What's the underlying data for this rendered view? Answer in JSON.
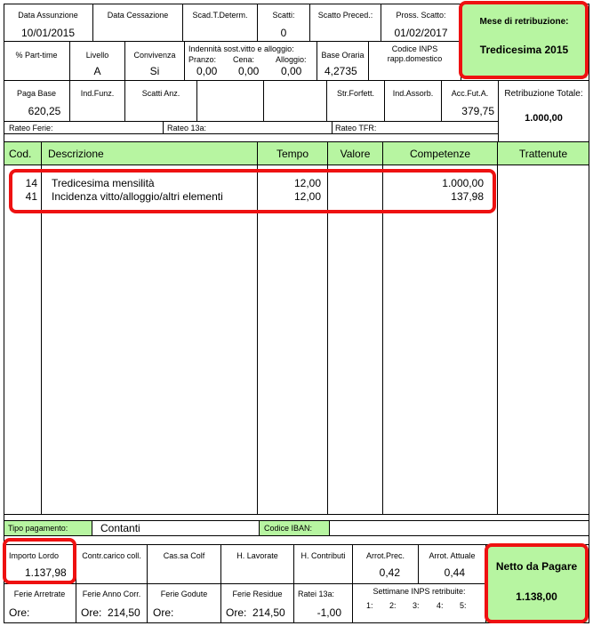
{
  "header_row1": {
    "data_assunzione": {
      "label": "Data Assunzione",
      "value": "10/01/2015"
    },
    "data_cessazione": {
      "label": "Data Cessazione",
      "value": ""
    },
    "scad_t_determ": {
      "label": "Scad.T.Determ.",
      "value": ""
    },
    "scatti": {
      "label": "Scatti:",
      "value": "0"
    },
    "scatto_preced": {
      "label": "Scatto Preced.:",
      "value": ""
    },
    "pross_scatto": {
      "label": "Pross. Scatto:",
      "value": "01/02/2017"
    }
  },
  "mese_retribuzione": {
    "label": "Mese di retribuzione:",
    "value": "Tredicesima 2015"
  },
  "header_row2": {
    "part_time": {
      "label": "% Part-time",
      "value": ""
    },
    "livello": {
      "label": "Livello",
      "value": "A"
    },
    "convivenza": {
      "label": "Convivenza",
      "value": "Si"
    },
    "indennita": {
      "label": "Indennità sost.vitto e alloggio:",
      "pranzo_label": "Pranzo:",
      "pranzo": "0,00",
      "cena_label": "Cena:",
      "cena": "0,00",
      "alloggio_label": "Alloggio:",
      "alloggio": "0,00"
    },
    "base_oraria": {
      "label": "Base Oraria",
      "value": "4,2735"
    },
    "codice_inps": {
      "label": "Codice INPS",
      "value": "rapp.domestico"
    }
  },
  "header_row3": {
    "paga_base": {
      "label": "Paga Base",
      "value": "620,25"
    },
    "ind_funz": {
      "label": "Ind.Funz.",
      "value": ""
    },
    "scatti_anz": {
      "label": "Scatti Anz.",
      "value": ""
    },
    "str_forfett": {
      "label": "Str.Forfett.",
      "value": ""
    },
    "ind_assorb": {
      "label": "Ind.Assorb.",
      "value": ""
    },
    "acc_fut_a": {
      "label": "Acc.Fut.A.",
      "value": "379,75"
    },
    "retribuzione_totale": {
      "label": "Retribuzione Totale:",
      "value": "1.000,00"
    }
  },
  "ratei": {
    "ferie": "Rateo Ferie:",
    "tredicesima": "Rateo 13a:",
    "tfr": "Rateo TFR:"
  },
  "table": {
    "columns": {
      "cod": "Cod.",
      "descrizione": "Descrizione",
      "tempo": "Tempo",
      "valore": "Valore",
      "competenze": "Competenze",
      "trattenute": "Trattenute"
    },
    "rows": [
      {
        "cod": "14",
        "descrizione": "Tredicesima mensilità",
        "tempo": "12,00",
        "valore": "",
        "competenze": "1.000,00",
        "trattenute": ""
      },
      {
        "cod": "41",
        "descrizione": "Incidenza vitto/alloggio/altri elementi",
        "tempo": "12,00",
        "valore": "",
        "competenze": "137,98",
        "trattenute": ""
      }
    ]
  },
  "pagamento": {
    "tipo_label": "Tipo pagamento:",
    "tipo_value": "Contanti",
    "iban_label": "Codice IBAN:",
    "iban_value": ""
  },
  "footer_row1": {
    "importo_lordo": {
      "label": "Importo Lordo",
      "value": "1.137,98"
    },
    "contr_carico_coll": {
      "label": "Contr.carico coll.",
      "value": ""
    },
    "cas_colf": {
      "label": "Cas.sa Colf",
      "value": ""
    },
    "h_lavorate": {
      "label": "H. Lavorate",
      "value": ""
    },
    "h_contributi": {
      "label": "H. Contributi",
      "value": ""
    },
    "arrot_prec": {
      "label": "Arrot.Prec.",
      "value": "0,42"
    },
    "arrot_attuale": {
      "label": "Arrot. Attuale",
      "value": "0,44"
    }
  },
  "netto": {
    "label": "Netto da Pagare",
    "value": "1.138,00"
  },
  "footer_row2": {
    "ferie_arretrate": {
      "label": "Ferie Arretrate",
      "ore_label": "Ore:",
      "value": ""
    },
    "ferie_anno_corr": {
      "label": "Ferie Anno Corr.",
      "ore_label": "Ore:",
      "value": "214,50"
    },
    "ferie_godute": {
      "label": "Ferie Godute",
      "ore_label": "Ore:",
      "value": ""
    },
    "ferie_residue": {
      "label": "Ferie Residue",
      "ore_label": "Ore:",
      "value": "214,50"
    },
    "ratei_13a": {
      "label": "Ratei 13a:",
      "value": "-1,00"
    },
    "settimane_inps": {
      "label": "Settimane INPS retribuite:",
      "w1": "1:",
      "w2": "2:",
      "w3": "3:",
      "w4": "4:",
      "w5": "5:"
    }
  },
  "colors": {
    "green": "#b7f5a1",
    "highlight_red": "#ee1111"
  }
}
